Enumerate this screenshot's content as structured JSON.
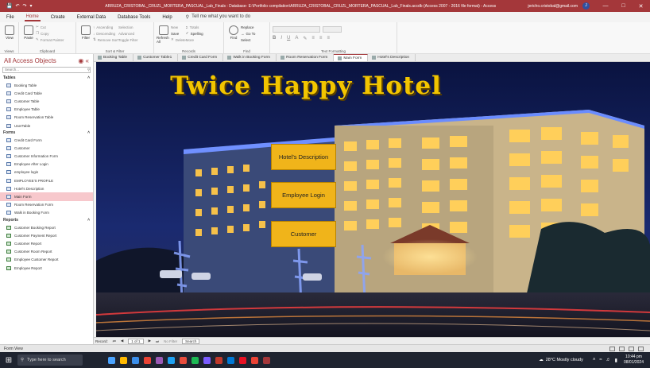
{
  "window": {
    "title": "ARRUZA_CRISTOBAL_CRUZL_MORTERA_PASCUAL_Lab_Finals : Database- E:\\Portfolio compilation\\ARRUZA_CRISTOBAL_CRUZL_MORTERA_PASCUAL_Lab_Finals.accdb (Access 2007 - 2016 file format) - Access",
    "user_email": "jericho.cristobal@gmail.com",
    "avatar_initial": "J",
    "accent": "#a4373a"
  },
  "menu": {
    "tabs": [
      "File",
      "Home",
      "Create",
      "External Data",
      "Database Tools",
      "Help"
    ],
    "active": "Home",
    "tell_me": "Tell me what you want to do"
  },
  "ribbon": {
    "views": {
      "view": "View",
      "label": "Views"
    },
    "clipboard": {
      "paste": "Paste",
      "cut": "Cut",
      "copy": "Copy",
      "format_painter": "Format Painter",
      "label": "Clipboard"
    },
    "sort_filter": {
      "filter": "Filter",
      "ascending": "Ascending",
      "descending": "Descending",
      "remove_sort": "Remove Sort",
      "selection": "Selection",
      "advanced": "Advanced",
      "toggle_filter": "Toggle Filter",
      "label": "Sort & Filter"
    },
    "records": {
      "refresh": "Refresh All",
      "new": "New",
      "save": "Save",
      "delete": "Delete",
      "totals": "Totals",
      "spelling": "Spelling",
      "more": "More",
      "label": "Records"
    },
    "find": {
      "find": "Find",
      "replace": "Replace",
      "goto": "Go To",
      "select": "Select",
      "label": "Find"
    },
    "text_formatting": {
      "bold": "B",
      "italic": "I",
      "underline": "U",
      "label": "Text Formatting"
    }
  },
  "object_tabs": [
    {
      "label": "Booking Table",
      "active": false
    },
    {
      "label": "Customer Table1",
      "active": false
    },
    {
      "label": "Credit Card Form",
      "active": false
    },
    {
      "label": "Walk in Booking Form",
      "active": false
    },
    {
      "label": "Room Reservation Form",
      "active": false
    },
    {
      "label": "Main Form",
      "active": true
    },
    {
      "label": "Hotel's Description",
      "active": false
    }
  ],
  "nav_pane": {
    "title": "All Access Objects",
    "search_placeholder": "Search...",
    "sections": [
      {
        "name": "Tables",
        "kind": "table",
        "items": [
          "Booking Table",
          "Credit Card Table",
          "Customer Table",
          "Employee Table",
          "Room Reservation Table",
          "UserTable"
        ]
      },
      {
        "name": "Forms",
        "kind": "form",
        "items": [
          "Credit Card Form",
          "Customer",
          "Customer Information Form",
          "Employee After Login",
          "employee login",
          "EMPLOYEE'S PROFILE",
          "Hotel's Description",
          "Main Form",
          "Room Reservation Form",
          "Walk in Booking Form"
        ]
      },
      {
        "name": "Reports",
        "kind": "rep",
        "items": [
          "Customer Booking Report",
          "Customer Payment Report",
          "Customer Report",
          "Customer Room Report",
          "Employee Customer Report",
          "Employee Report"
        ]
      }
    ],
    "selected": "Main Form"
  },
  "form": {
    "heading": "Twice Happy Hotel",
    "buttons": [
      "Hotel's Description",
      "Employee Login",
      "Customer"
    ],
    "button_color": "#f0b41a"
  },
  "record_nav": {
    "label": "Record:",
    "position": "1 of 1",
    "filter": "No Filter",
    "search": "Search"
  },
  "status": {
    "text": "Form View"
  },
  "taskbar": {
    "search_placeholder": "Type here to search",
    "weather": "28°C  Mostly cloudy",
    "time": "10:44 pm",
    "date": "08/01/2024"
  }
}
